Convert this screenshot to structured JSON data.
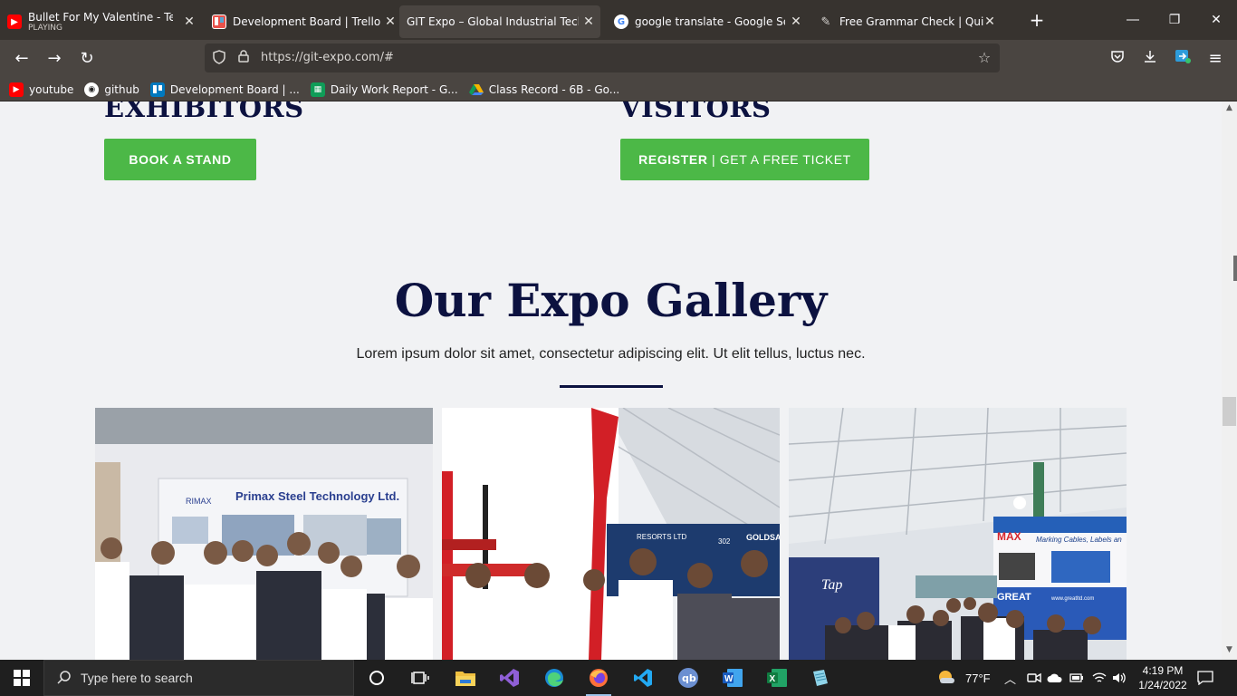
{
  "browser": {
    "tabs": [
      {
        "title": "Bullet For My Valentine - Tears D",
        "subtitle": "PLAYING",
        "icon": "youtube-icon",
        "color": "#ff0000"
      },
      {
        "title": "Development Board | Trello",
        "icon": "trello-icon",
        "color": "#e8514a"
      },
      {
        "title": "GIT Expo – Global Industrial Technol",
        "icon": "",
        "color": ""
      },
      {
        "title": "google translate - Google Search",
        "icon": "google-icon",
        "color": "#4285f4"
      },
      {
        "title": "Free Grammar Check | QuillBot",
        "icon": "quillbot-icon",
        "color": "#d8d5d2"
      }
    ],
    "active_tab": 2,
    "url": "https://git-expo.com/#",
    "bookmarks": [
      {
        "label": "youtube",
        "icon": "youtube-icon",
        "color": "#ff0000"
      },
      {
        "label": "github",
        "icon": "github-icon",
        "color": "#ffffff"
      },
      {
        "label": "Development Board | ...",
        "icon": "trello-icon",
        "color": "#0079bf"
      },
      {
        "label": "Daily Work Report - G...",
        "icon": "sheets-icon",
        "color": "#0f9d58"
      },
      {
        "label": "Class Record - 6B - Go...",
        "icon": "drive-icon",
        "color": "#f4b400"
      }
    ]
  },
  "page": {
    "exhibitors_heading": "EXHIBITORS",
    "visitors_heading": "VISITORS",
    "book_stand": "BOOK A STAND",
    "register_bold": "REGISTER",
    "register_rest": " | GET A FREE TICKET",
    "gallery_title": "Our Expo Gallery",
    "gallery_subtitle": "Lorem ipsum dolor sit amet, consectetur adipiscing elit. Ut elit tellus, luctus nec.",
    "photos": [
      {
        "sign": "Primax Steel Technology Ltd.",
        "logo": "RIMAX"
      },
      {
        "sign": "GOLDSAN",
        "sub": "RESORTS LTD",
        "num": "302"
      },
      {
        "sign": "MAX",
        "slogan": "Marking Cables, Labels an",
        "brand": "GREAT",
        "tap": "Tap",
        "url": "www.greatltd.com"
      }
    ],
    "accent_color": "#4cb847",
    "heading_color": "#0c1240"
  },
  "taskbar": {
    "search_placeholder": "Type here to search",
    "weather": "77°F",
    "time": "4:19 PM",
    "date": "1/24/2022"
  }
}
